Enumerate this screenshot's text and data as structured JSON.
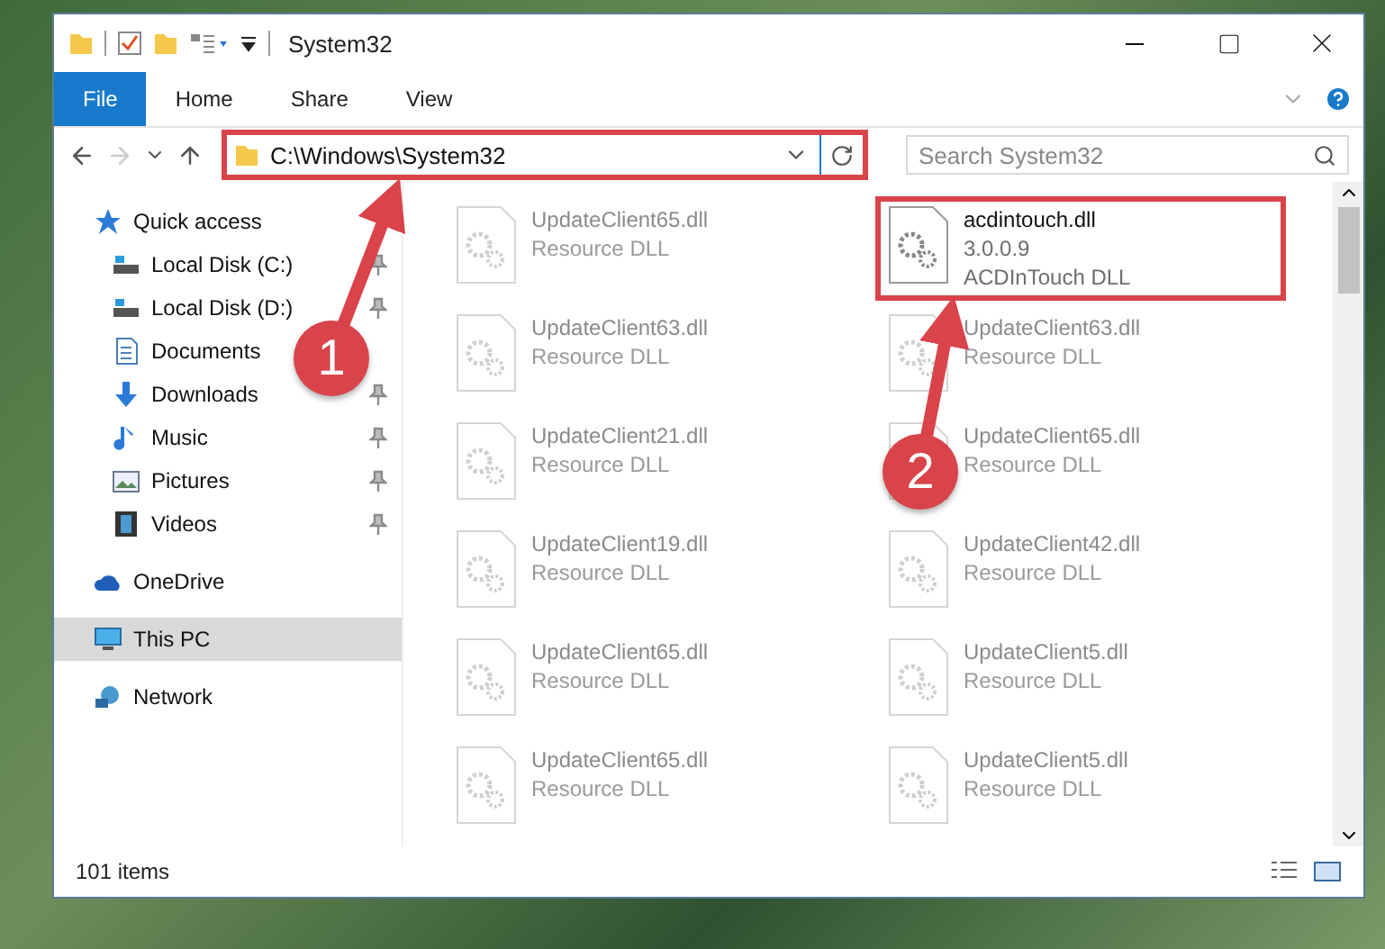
{
  "window": {
    "title": "System32"
  },
  "ribbon_tabs": [
    {
      "label": "File",
      "selected": true
    },
    {
      "label": "Home",
      "selected": false
    },
    {
      "label": "Share",
      "selected": false
    },
    {
      "label": "View",
      "selected": false
    }
  ],
  "address": {
    "path": "C:\\Windows\\System32",
    "highlighted": true
  },
  "search": {
    "placeholder": "Search System32"
  },
  "sidebar": [
    {
      "label": "Quick access",
      "kind": "star",
      "selected": false,
      "children": [
        {
          "label": "Local Disk (C:)",
          "kind": "drive",
          "pinned": true,
          "selected": false
        },
        {
          "label": "Local Disk (D:)",
          "kind": "drive",
          "pinned": true,
          "selected": false
        },
        {
          "label": "Documents",
          "kind": "document",
          "pinned": false,
          "selected": false
        },
        {
          "label": "Downloads",
          "kind": "download",
          "pinned": true,
          "selected": false
        },
        {
          "label": "Music",
          "kind": "music",
          "pinned": true,
          "selected": false
        },
        {
          "label": "Pictures",
          "kind": "picture",
          "pinned": true,
          "selected": false
        },
        {
          "label": "Videos",
          "kind": "video",
          "pinned": true,
          "selected": false
        }
      ]
    },
    {
      "label": "OneDrive",
      "kind": "cloud",
      "selected": false
    },
    {
      "label": "This PC",
      "kind": "pc",
      "selected": true
    },
    {
      "label": "Network",
      "kind": "network",
      "selected": false
    }
  ],
  "files": [
    {
      "name": "UpdateClient65.dll",
      "details": [
        "Resource DLL"
      ],
      "highlighted": false
    },
    {
      "name": "acdintouch.dll",
      "details": [
        "3.0.0.9",
        "ACDInTouch DLL"
      ],
      "highlighted": true
    },
    {
      "name": "UpdateClient63.dll",
      "details": [
        "Resource DLL"
      ],
      "highlighted": false
    },
    {
      "name": "UpdateClient63.dll",
      "details": [
        "Resource DLL"
      ],
      "highlighted": false
    },
    {
      "name": "UpdateClient21.dll",
      "details": [
        "Resource DLL"
      ],
      "highlighted": false
    },
    {
      "name": "UpdateClient65.dll",
      "details": [
        "Resource DLL"
      ],
      "highlighted": false
    },
    {
      "name": "UpdateClient19.dll",
      "details": [
        "Resource DLL"
      ],
      "highlighted": false
    },
    {
      "name": "UpdateClient42.dll",
      "details": [
        "Resource DLL"
      ],
      "highlighted": false
    },
    {
      "name": "UpdateClient65.dll",
      "details": [
        "Resource DLL"
      ],
      "highlighted": false
    },
    {
      "name": "UpdateClient5.dll",
      "details": [
        "Resource DLL"
      ],
      "highlighted": false
    },
    {
      "name": "UpdateClient65.dll",
      "details": [
        "Resource DLL"
      ],
      "highlighted": false
    },
    {
      "name": "UpdateClient5.dll",
      "details": [
        "Resource DLL"
      ],
      "highlighted": false
    }
  ],
  "status_bar": {
    "item_count": "101 items"
  },
  "annotations": [
    {
      "number": "1"
    },
    {
      "number": "2"
    }
  ]
}
